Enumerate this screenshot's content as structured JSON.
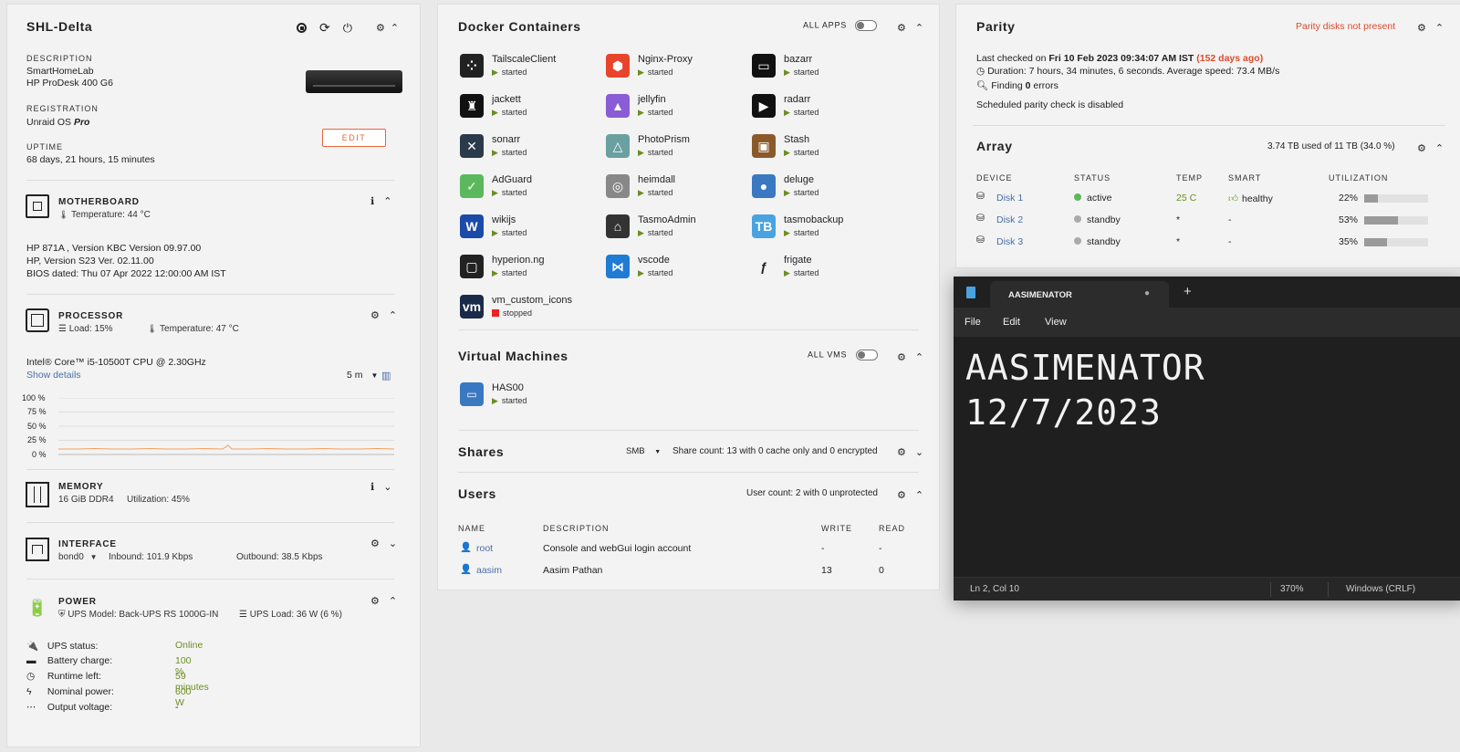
{
  "system": {
    "title": "SHL-Delta",
    "description_label": "DESCRIPTION",
    "description_line1": "SmartHomeLab",
    "description_line2": "HP ProDesk 400 G6",
    "registration_label": "REGISTRATION",
    "registration_prefix": "Unraid OS",
    "registration_tier": "Pro",
    "edit_label": "EDIT",
    "uptime_label": "UPTIME",
    "uptime_value": "68 days, 21 hours, 15 minutes"
  },
  "motherboard": {
    "title": "MOTHERBOARD",
    "temp": "Temperature: 44 °C",
    "line1": "HP 871A , Version KBC Version 09.97.00",
    "line2": "HP, Version S23 Ver. 02.11.00",
    "line3": "BIOS dated: Thu 07 Apr 2022 12:00:00 AM IST"
  },
  "processor": {
    "title": "PROCESSOR",
    "load": "Load: 15%",
    "temp": "Temperature: 47 °C",
    "model": "Intel® Core™ i5-10500T CPU @ 2.30GHz",
    "show_details": "Show details",
    "interval": "5 m",
    "axis_labels": [
      "100 %",
      "75 %",
      "50 %",
      "25 %",
      "0 %"
    ]
  },
  "memory": {
    "title": "MEMORY",
    "size": "16 GiB DDR4",
    "utilization": "Utilization: 45%"
  },
  "interface": {
    "title": "INTERFACE",
    "name": "bond0",
    "inbound": "Inbound: 101.9 Kbps",
    "outbound": "Outbound: 38.5 Kbps"
  },
  "power": {
    "title": "POWER",
    "ups_model": "UPS Model: Back-UPS RS 1000G-IN",
    "ups_load": "UPS Load: 36 W (6 %)",
    "rows": [
      {
        "label": "UPS status:",
        "value": "Online"
      },
      {
        "label": "Battery charge:",
        "value": "100 %"
      },
      {
        "label": "Runtime left:",
        "value": "59 minutes"
      },
      {
        "label": "Nominal power:",
        "value": "600 W"
      },
      {
        "label": "Output voltage:",
        "value": "-"
      }
    ]
  },
  "docker": {
    "title": "Docker Containers",
    "all_apps": "ALL APPS",
    "containers": [
      {
        "name": "TailscaleClient",
        "status": "started",
        "color": "#222222",
        "glyph": "⁘"
      },
      {
        "name": "Nginx-Proxy",
        "status": "started",
        "color": "#e8442c",
        "glyph": "⬢"
      },
      {
        "name": "bazarr",
        "status": "started",
        "color": "#111111",
        "glyph": "▭"
      },
      {
        "name": "jackett",
        "status": "started",
        "color": "#111111",
        "glyph": "♜"
      },
      {
        "name": "jellyfin",
        "status": "started",
        "color": "#8a5cd6",
        "glyph": "▲"
      },
      {
        "name": "radarr",
        "status": "started",
        "color": "#111111",
        "glyph": "▶"
      },
      {
        "name": "sonarr",
        "status": "started",
        "color": "#2a3a4a",
        "glyph": "✕"
      },
      {
        "name": "PhotoPrism",
        "status": "started",
        "color": "#6aa0a0",
        "glyph": "△"
      },
      {
        "name": "Stash",
        "status": "started",
        "color": "#8b5a2b",
        "glyph": "▣"
      },
      {
        "name": "AdGuard",
        "status": "started",
        "color": "#5cb85c",
        "glyph": "✓"
      },
      {
        "name": "heimdall",
        "status": "started",
        "color": "#888888",
        "glyph": "◎"
      },
      {
        "name": "deluge",
        "status": "started",
        "color": "#3a78c2",
        "glyph": "●"
      },
      {
        "name": "wikijs",
        "status": "started",
        "color": "#1b4aa8",
        "glyph": "W"
      },
      {
        "name": "TasmoAdmin",
        "status": "started",
        "color": "#333333",
        "glyph": "⌂"
      },
      {
        "name": "tasmobackup",
        "status": "started",
        "color": "#4aa3e0",
        "glyph": "TB"
      },
      {
        "name": "hyperion.ng",
        "status": "started",
        "color": "#222222",
        "glyph": "▢"
      },
      {
        "name": "vscode",
        "status": "started",
        "color": "#1f7bd4",
        "glyph": "⋈"
      },
      {
        "name": "frigate",
        "status": "started",
        "color": "#f3f3f3",
        "glyph": "ƒ"
      },
      {
        "name": "vm_custom_icons",
        "status": "stopped",
        "color": "#1a2a4a",
        "glyph": "vm"
      }
    ]
  },
  "vms": {
    "title": "Virtual Machines",
    "all_vms": "ALL VMS",
    "items": [
      {
        "name": "HAS00",
        "status": "started"
      }
    ]
  },
  "shares": {
    "title": "Shares",
    "protocol": "SMB",
    "summary": "Share count: 13 with 0 cache only and 0 encrypted"
  },
  "users": {
    "title": "Users",
    "summary": "User count: 2 with 0 unprotected",
    "headers": {
      "name": "NAME",
      "description": "DESCRIPTION",
      "write": "WRITE",
      "read": "READ"
    },
    "rows": [
      {
        "name": "root",
        "description": "Console and webGui login account",
        "write": "-",
        "read": "-"
      },
      {
        "name": "aasim",
        "description": "Aasim Pathan",
        "write": "13",
        "read": "0"
      }
    ]
  },
  "parity": {
    "title": "Parity",
    "warning": "Parity disks not present",
    "last_checked_prefix": "Last checked on",
    "last_checked_date": "Fri 10 Feb 2023 09:34:07 AM IST",
    "last_checked_ago": "(152 days ago)",
    "duration": "Duration: 7 hours, 34 minutes, 6 seconds. Average speed: 73.4 MB/s",
    "finding_prefix": "Finding",
    "finding_count": "0",
    "finding_suffix": "errors",
    "scheduled": "Scheduled parity check is disabled"
  },
  "array": {
    "title": "Array",
    "summary": "3.74 TB used of 11 TB (34.0 %)",
    "headers": {
      "device": "DEVICE",
      "status": "STATUS",
      "temp": "TEMP",
      "smart": "SMART",
      "util": "UTILIZATION"
    },
    "disks": [
      {
        "name": "Disk 1",
        "status": "active",
        "status_color": "#5cb85c",
        "temp": "25 C",
        "smart": "healthy",
        "util": "22%",
        "util_frac": 0.22
      },
      {
        "name": "Disk 2",
        "status": "standby",
        "status_color": "#aaaaaa",
        "temp": "*",
        "smart": "-",
        "util": "53%",
        "util_frac": 0.53
      },
      {
        "name": "Disk 3",
        "status": "standby",
        "status_color": "#aaaaaa",
        "temp": "*",
        "smart": "-",
        "util": "35%",
        "util_frac": 0.35
      }
    ]
  },
  "notepad": {
    "tab_title": "AASIMENATOR",
    "menu": [
      "File",
      "Edit",
      "View"
    ],
    "line1": "AASIMENATOR",
    "line2": "12/7/2023",
    "status_pos": "Ln 2, Col 10",
    "status_zoom": "370%",
    "status_eol": "Windows (CRLF)"
  }
}
